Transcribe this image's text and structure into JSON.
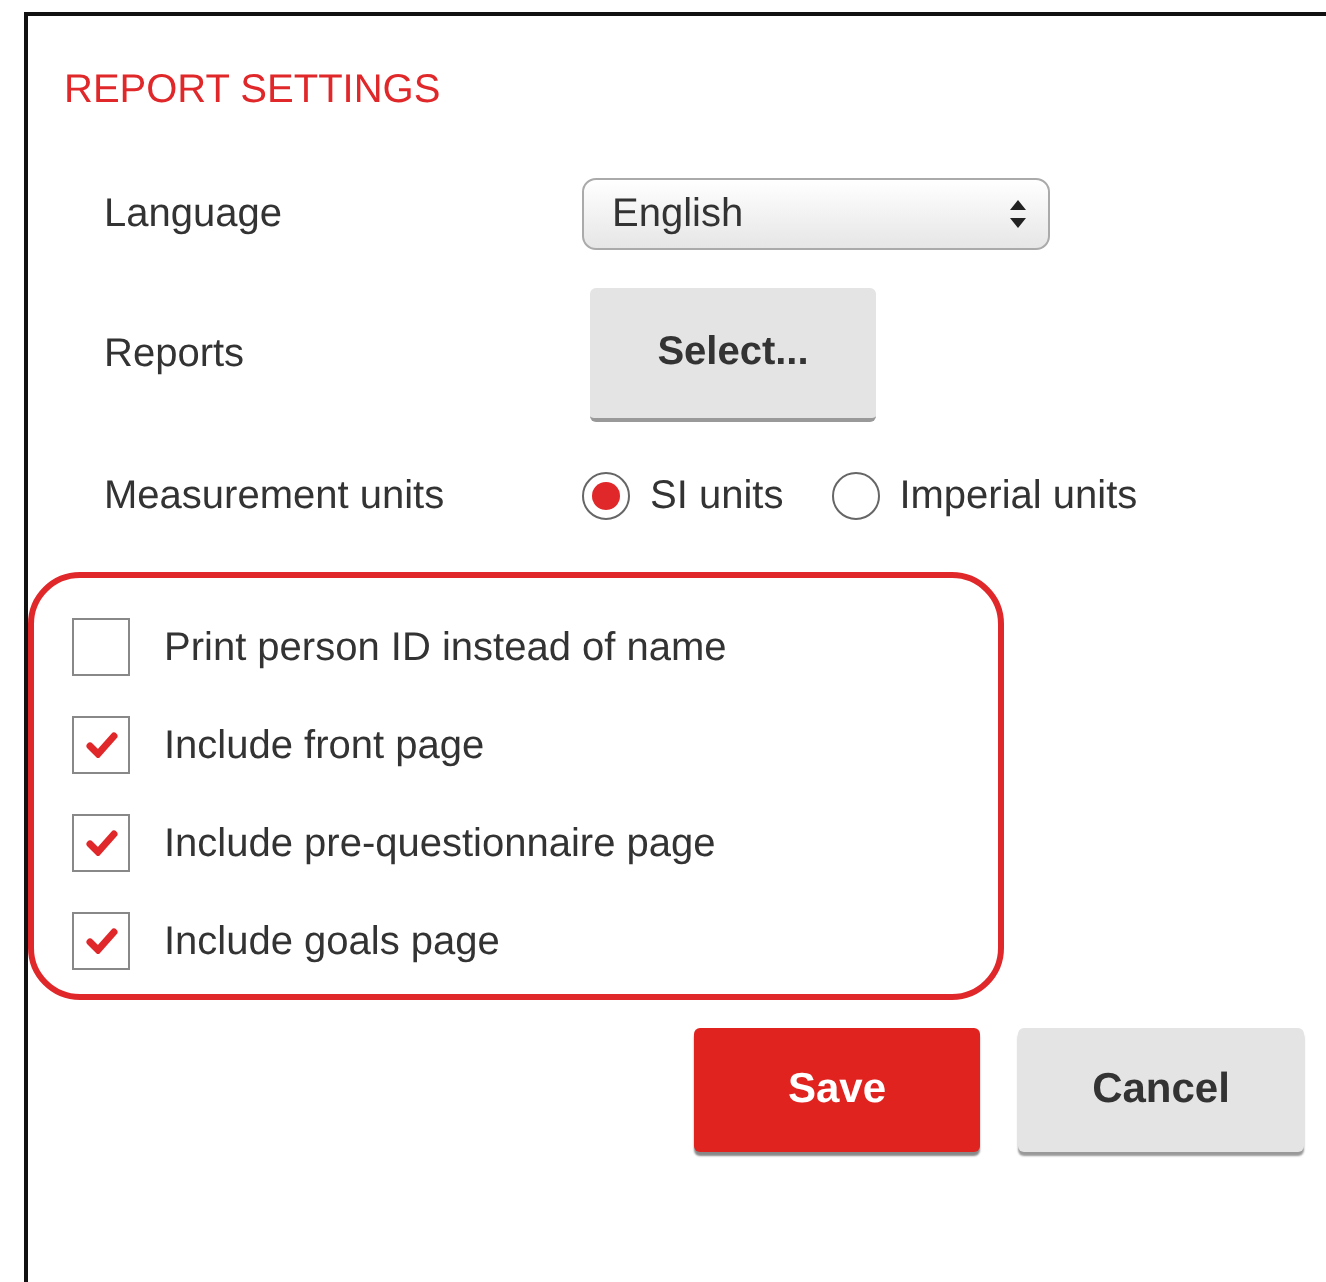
{
  "title": "REPORT SETTINGS",
  "fields": [
    {
      "kind": "select",
      "label": "Language",
      "value": "English"
    },
    {
      "kind": "button",
      "label": "Reports",
      "button": "Select..."
    },
    {
      "kind": "radio",
      "label": "Measurement units",
      "options": [
        {
          "label": "SI units",
          "selected": true
        },
        {
          "label": "Imperial units",
          "selected": false
        }
      ]
    }
  ],
  "options": {
    "highlighted": true,
    "items": [
      {
        "label": "Print person ID instead of name",
        "checked": false
      },
      {
        "label": "Include front page",
        "checked": true
      },
      {
        "label": "Include pre-questionnaire page",
        "checked": true
      },
      {
        "label": "Include goals page",
        "checked": true
      }
    ]
  },
  "buttons": [
    {
      "label": "Save",
      "kind": "primary"
    },
    {
      "label": "Cancel",
      "kind": "secondary"
    }
  ]
}
